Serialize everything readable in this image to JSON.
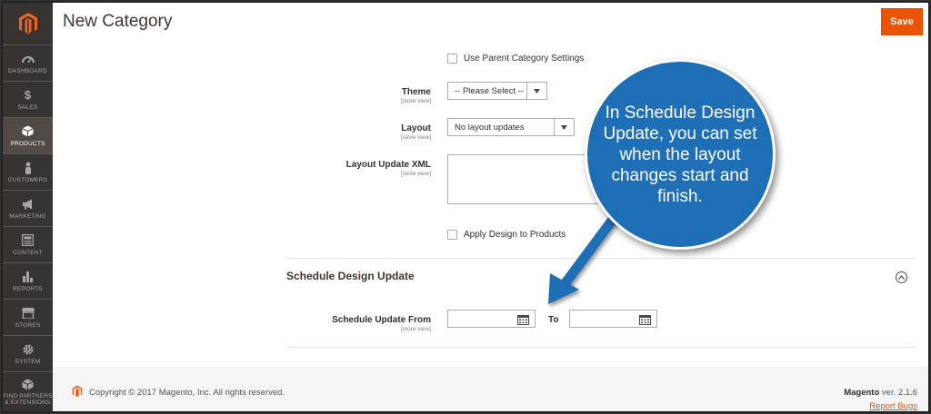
{
  "page": {
    "title": "New Category",
    "save_label": "Save"
  },
  "sidebar": {
    "items": [
      {
        "label": "DASHBOARD",
        "icon": "dashboard-icon"
      },
      {
        "label": "SALES",
        "icon": "dollar-icon"
      },
      {
        "label": "PRODUCTS",
        "icon": "cube-icon",
        "active": true
      },
      {
        "label": "CUSTOMERS",
        "icon": "person-icon"
      },
      {
        "label": "MARKETING",
        "icon": "megaphone-icon"
      },
      {
        "label": "CONTENT",
        "icon": "content-icon"
      },
      {
        "label": "REPORTS",
        "icon": "bar-chart-icon"
      },
      {
        "label": "STORES",
        "icon": "store-icon"
      },
      {
        "label": "SYSTEM",
        "icon": "gear-icon"
      },
      {
        "label": "FIND PARTNERS & EXTENSIONS",
        "icon": "cube-stack-icon"
      }
    ]
  },
  "form": {
    "use_parent_label": "Use Parent Category Settings",
    "theme": {
      "label": "Theme",
      "scope": "[store view]",
      "value": "-- Please Select --"
    },
    "layout": {
      "label": "Layout",
      "scope": "[store view]",
      "value": "No layout updates"
    },
    "layout_xml": {
      "label": "Layout Update XML",
      "scope": "[store view]",
      "value": ""
    },
    "apply_design_label": "Apply Design to Products",
    "schedule": {
      "section_title": "Schedule Design Update",
      "from_label": "Schedule Update From",
      "scope": "[store view]",
      "to_label": "To",
      "from_value": "",
      "to_value": ""
    }
  },
  "callout": {
    "text": "In Schedule Design Update, you can set when the layout changes start and finish."
  },
  "footer": {
    "copyright": "Copyright © 2017 Magento, Inc. All rights reserved.",
    "brand": "Magento",
    "version": "ver. 2.1.6",
    "report_bugs": "Report Bugs"
  },
  "colors": {
    "accent": "#eb5202",
    "sidebar": "#373330",
    "callout": "#1f6fb6"
  }
}
